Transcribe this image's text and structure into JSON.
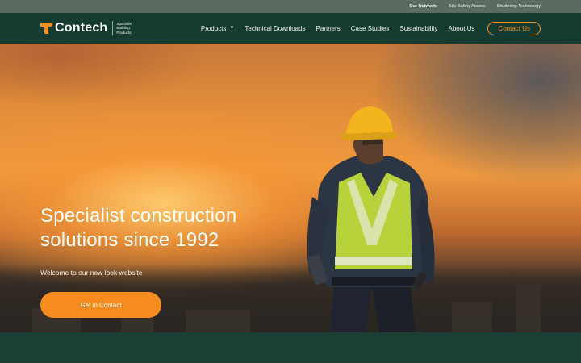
{
  "topbar": {
    "network_label": "Our Network:",
    "links": [
      "Site Safety Access",
      "Shuttering Technology"
    ]
  },
  "brand": {
    "name": "Contech",
    "tagline_lines": [
      "Specialist",
      "Building",
      "Products"
    ],
    "accent_color": "#f68b1f",
    "header_color": "#163c31"
  },
  "nav": {
    "items": [
      {
        "label": "Products",
        "has_dropdown": true,
        "icon": "chevron-down-icon"
      },
      {
        "label": "Technical Downloads"
      },
      {
        "label": "Partners"
      },
      {
        "label": "Case Studies"
      },
      {
        "label": "Sustainability"
      },
      {
        "label": "About Us"
      }
    ],
    "caret_glyph": "▼",
    "contact_label": "Contact Us"
  },
  "hero": {
    "title_line1": "Specialist construction",
    "title_line2": "solutions since 1992",
    "subtitle": "Welcome to our new look website",
    "cta_label": "Get in Contact"
  }
}
